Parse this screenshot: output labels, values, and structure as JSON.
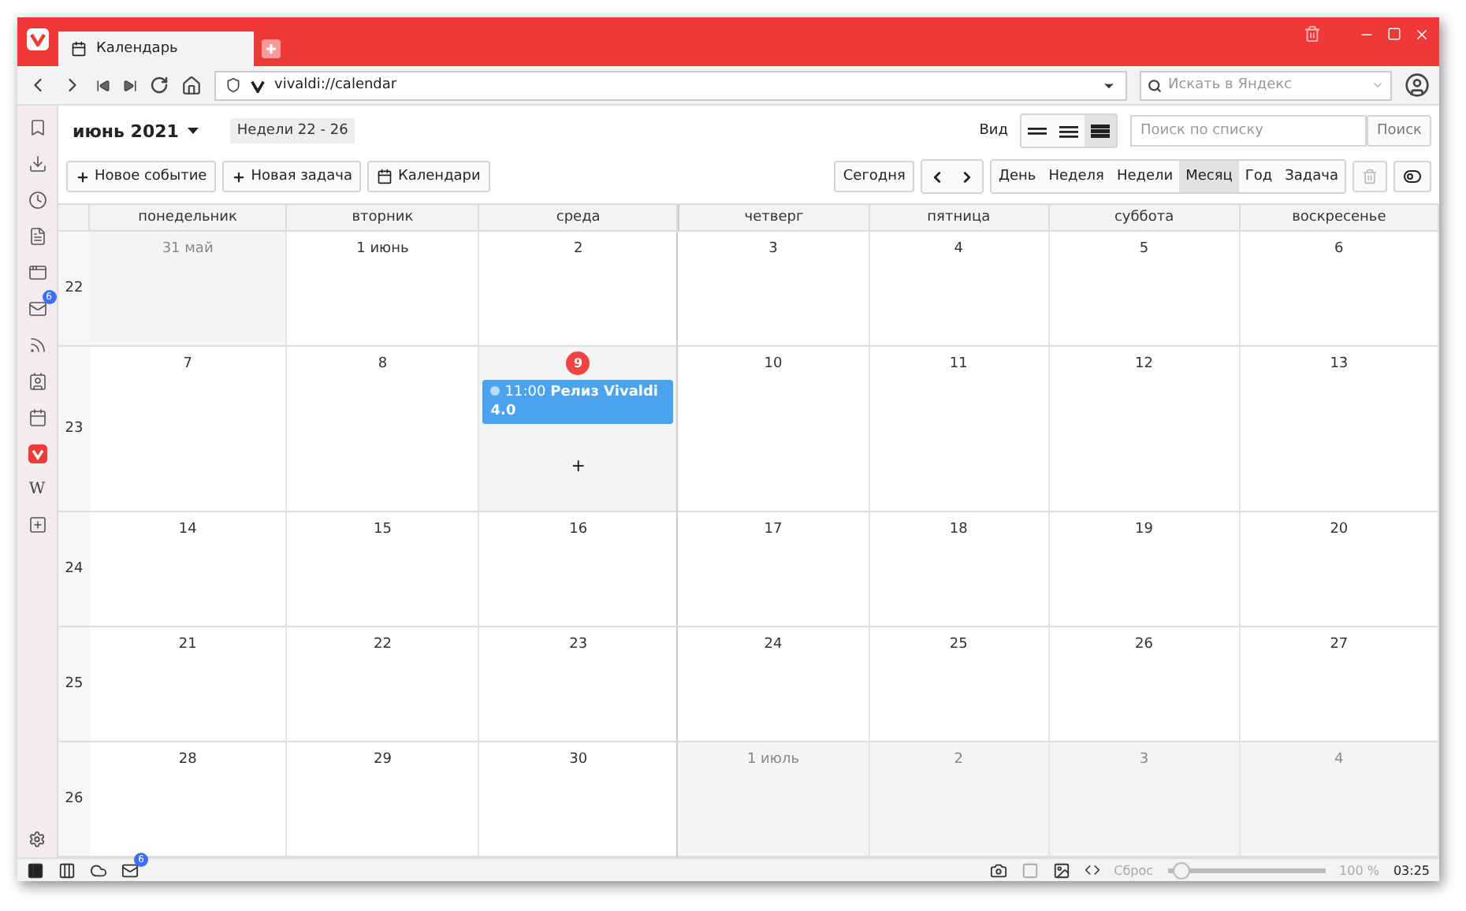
{
  "window": {
    "tab_title": "Календарь"
  },
  "address_bar": {
    "url": "vivaldi://calendar",
    "search_placeholder": "Искать в Яндекс"
  },
  "side_panel": {
    "items": [
      {
        "kind": "bookmark"
      },
      {
        "kind": "download"
      },
      {
        "kind": "history"
      },
      {
        "kind": "notes"
      },
      {
        "kind": "window"
      },
      {
        "kind": "mail",
        "badge": "6"
      },
      {
        "kind": "feed"
      },
      {
        "kind": "contacts"
      },
      {
        "kind": "calendar"
      },
      {
        "kind": "vivaldi"
      },
      {
        "kind": "text",
        "label": "W"
      },
      {
        "kind": "add"
      }
    ]
  },
  "calendar": {
    "month": "июнь 2021",
    "weeks_range": "Недели 22 - 26",
    "view_label": "Вид",
    "layouts": [
      {
        "selected": false
      },
      {
        "selected": false
      },
      {
        "selected": true
      }
    ],
    "search": {
      "placeholder": "Поиск по списку",
      "button": "Поиск"
    },
    "actions": [
      {
        "kind": "plus",
        "label": "Новое событие"
      },
      {
        "kind": "plus",
        "label": "Новая задача"
      },
      {
        "kind": "calendar",
        "label": "Календари"
      }
    ],
    "today_button": "Сегодня",
    "views": [
      {
        "label": "День",
        "selected": false
      },
      {
        "label": "Неделя",
        "selected": false
      },
      {
        "label": "Недели",
        "selected": false
      },
      {
        "label": "Месяц",
        "selected": true
      },
      {
        "label": "Год",
        "selected": false
      },
      {
        "label": "Задача",
        "selected": false
      }
    ],
    "weekdays": [
      "понедельник",
      "вторник",
      "среда",
      "четверг",
      "пятница",
      "суббота",
      "воскресенье"
    ],
    "add_hint": "+",
    "weeks": [
      {
        "number": "22",
        "days": [
          {
            "label": "31 май",
            "other_month": true,
            "selected": false
          },
          {
            "label": "1 июнь",
            "other_month": false,
            "selected": false
          },
          {
            "label": "2",
            "other_month": false,
            "selected": false
          },
          {
            "label": "3",
            "other_month": false,
            "selected": false
          },
          {
            "label": "4",
            "other_month": false,
            "selected": false
          },
          {
            "label": "5",
            "other_month": false,
            "selected": false
          },
          {
            "label": "6",
            "other_month": false,
            "selected": false
          }
        ]
      },
      {
        "number": "23",
        "days": [
          {
            "label": "7",
            "other_month": false,
            "selected": false
          },
          {
            "label": "8",
            "other_month": false,
            "selected": false
          },
          {
            "label": "9",
            "other_month": false,
            "selected": true,
            "today": true,
            "events": [
              {
                "text": "11:00 **Релиз Vivaldi 4.0**"
              }
            ]
          },
          {
            "label": "10",
            "other_month": false,
            "selected": false
          },
          {
            "label": "11",
            "other_month": false,
            "selected": false
          },
          {
            "label": "12",
            "other_month": false,
            "selected": false
          },
          {
            "label": "13",
            "other_month": false,
            "selected": false
          }
        ]
      },
      {
        "number": "24",
        "days": [
          {
            "label": "14",
            "other_month": false,
            "selected": false
          },
          {
            "label": "15",
            "other_month": false,
            "selected": false
          },
          {
            "label": "16",
            "other_month": false,
            "selected": false
          },
          {
            "label": "17",
            "other_month": false,
            "selected": false
          },
          {
            "label": "18",
            "other_month": false,
            "selected": false
          },
          {
            "label": "19",
            "other_month": false,
            "selected": false
          },
          {
            "label": "20",
            "other_month": false,
            "selected": false
          }
        ]
      },
      {
        "number": "25",
        "days": [
          {
            "label": "21",
            "other_month": false,
            "selected": false
          },
          {
            "label": "22",
            "other_month": false,
            "selected": false
          },
          {
            "label": "23",
            "other_month": false,
            "selected": false
          },
          {
            "label": "24",
            "other_month": false,
            "selected": false
          },
          {
            "label": "25",
            "other_month": false,
            "selected": false
          },
          {
            "label": "26",
            "other_month": false,
            "selected": false
          },
          {
            "label": "27",
            "other_month": false,
            "selected": false
          }
        ]
      },
      {
        "number": "26",
        "days": [
          {
            "label": "28",
            "other_month": false,
            "selected": false
          },
          {
            "label": "29",
            "other_month": false,
            "selected": false
          },
          {
            "label": "30",
            "other_month": false,
            "selected": false
          },
          {
            "label": "1 июль",
            "other_month": true,
            "selected": false
          },
          {
            "label": "2",
            "other_month": true,
            "selected": false
          },
          {
            "label": "3",
            "other_month": true,
            "selected": false
          },
          {
            "label": "4",
            "other_month": true,
            "selected": false
          }
        ]
      }
    ]
  },
  "status_bar": {
    "mail_badge": "6",
    "reset": "Сброс",
    "zoom": {
      "level": 0.08
    },
    "zoom_reading": "100 %",
    "clock": "03:25"
  }
}
